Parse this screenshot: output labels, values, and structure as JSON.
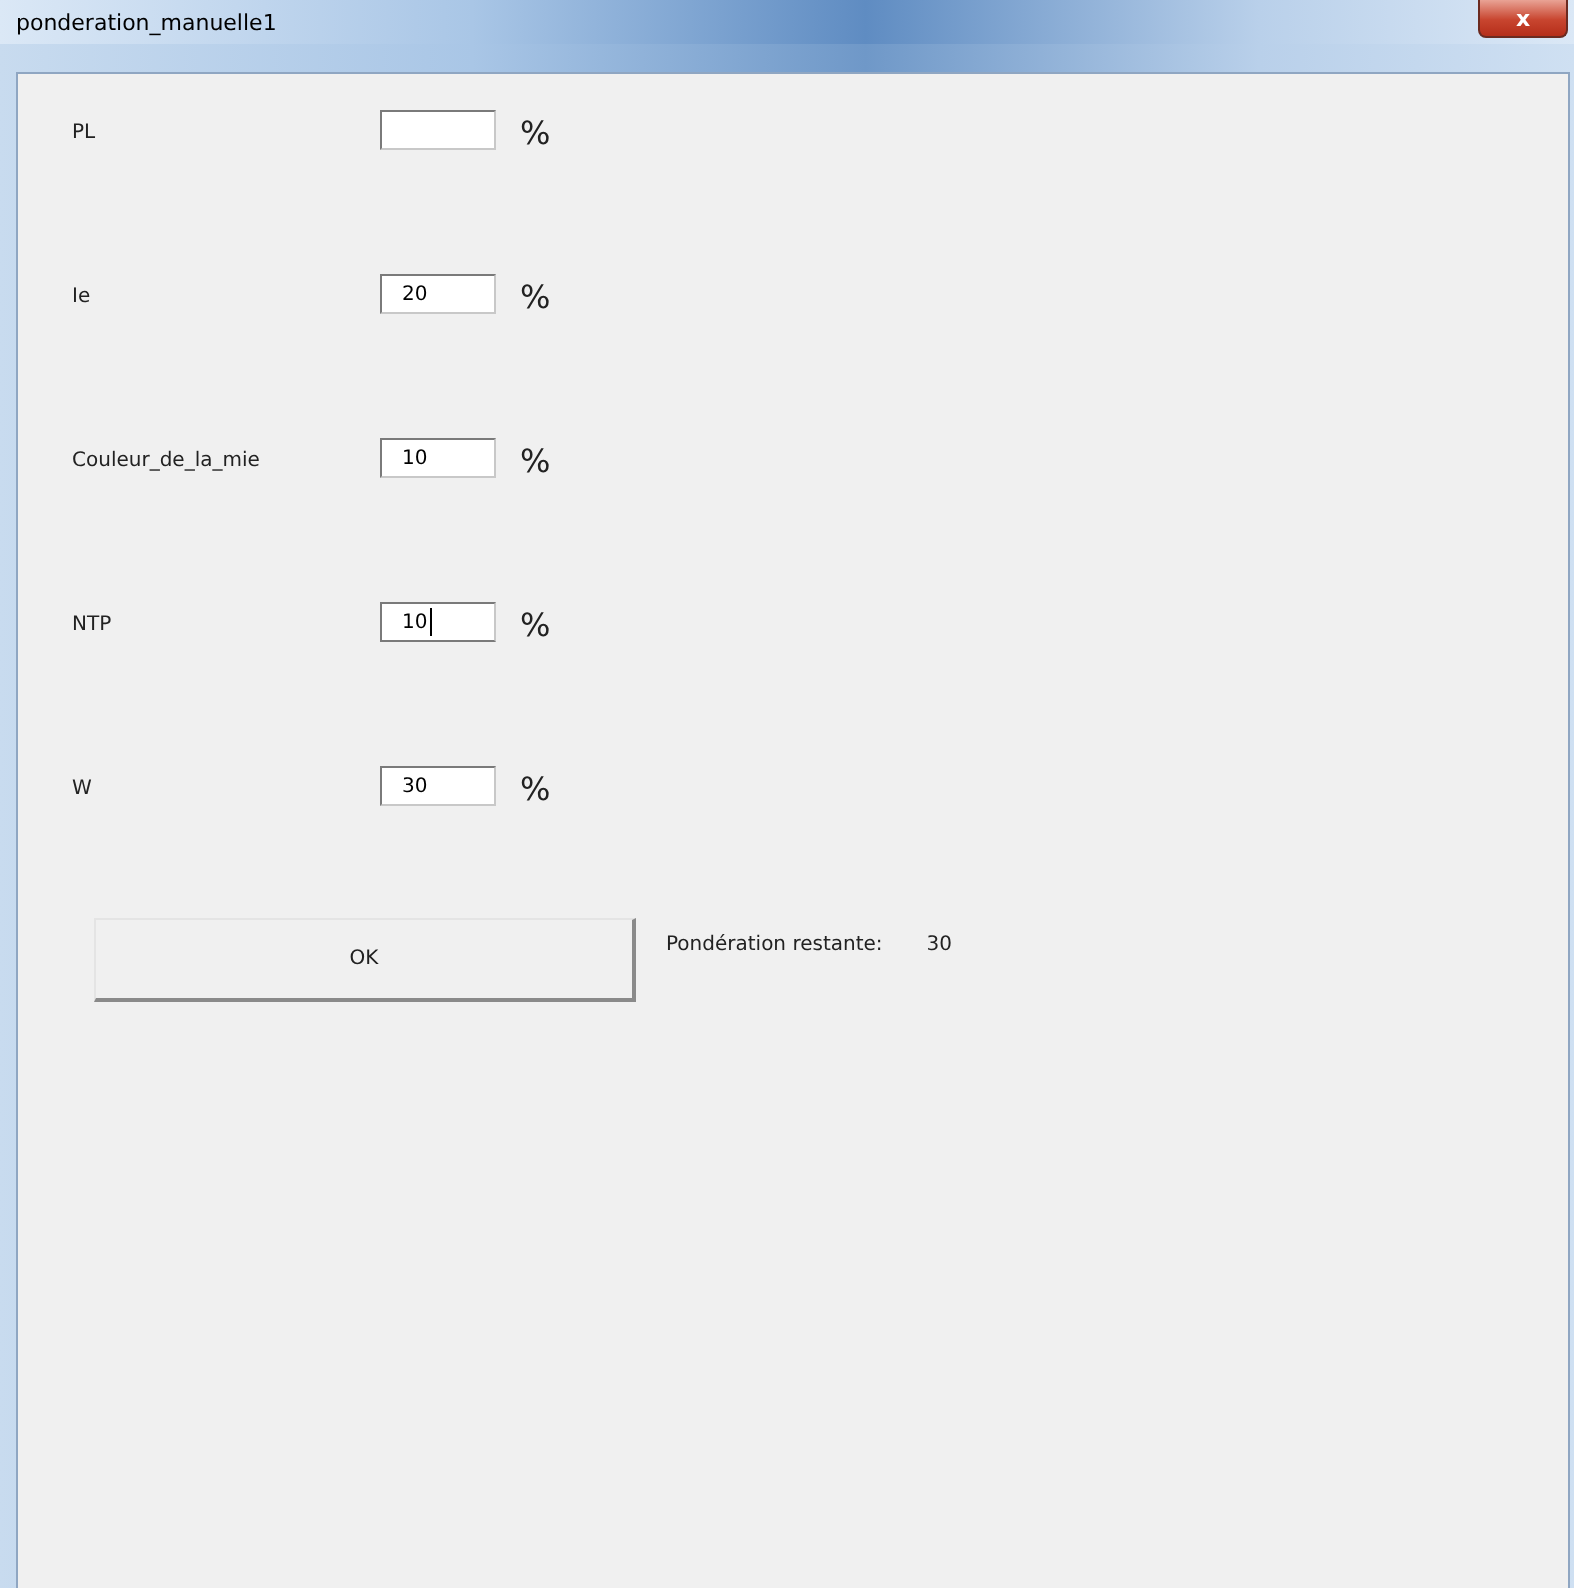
{
  "window": {
    "title": "ponderation_manuelle1",
    "close_label": "x"
  },
  "fields": [
    {
      "label": "PL",
      "unit": "%",
      "focused": false
    },
    {
      "label": "Ie",
      "value": "20",
      "unit": "%",
      "focused": false
    },
    {
      "label": "Couleur_de_la_mie",
      "value": "10",
      "unit": "%",
      "focused": false
    },
    {
      "label": "NTP",
      "value": "10",
      "unit": "%",
      "focused": true
    },
    {
      "label": "W",
      "value": "30",
      "unit": "%",
      "focused": false
    }
  ],
  "ok_button": "OK",
  "remaining": {
    "label": "Pondération restante:",
    "value": "30"
  }
}
